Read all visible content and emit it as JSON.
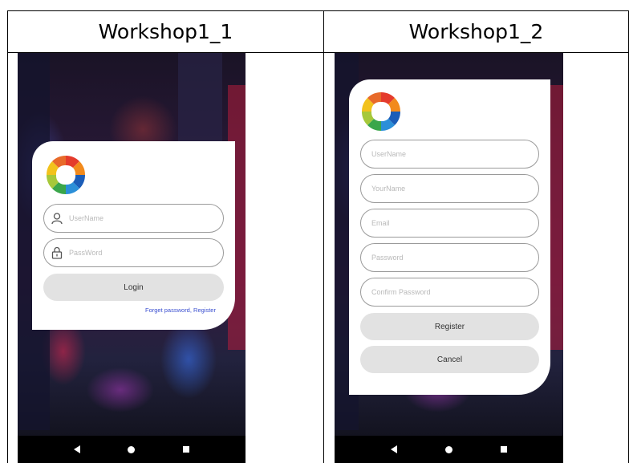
{
  "table": {
    "col1_header": "Workshop1_1",
    "col2_header": "Workshop1_2"
  },
  "login_screen": {
    "username_placeholder": "UserName",
    "password_placeholder": "PassWord",
    "login_label": "Login",
    "links": "Forget password, Register"
  },
  "register_screen": {
    "username_placeholder": "UserName",
    "yourname_placeholder": "YourName",
    "email_placeholder": "Email",
    "password_placeholder": "Password",
    "confirm_placeholder": "Confirm Password",
    "register_label": "Register",
    "cancel_label": "Cancel"
  },
  "icons": {
    "logo": "colorful-people-circle-logo",
    "user": "user-icon",
    "lock": "lock-icon",
    "back": "back-icon",
    "home": "home-icon",
    "recents": "recents-icon"
  }
}
